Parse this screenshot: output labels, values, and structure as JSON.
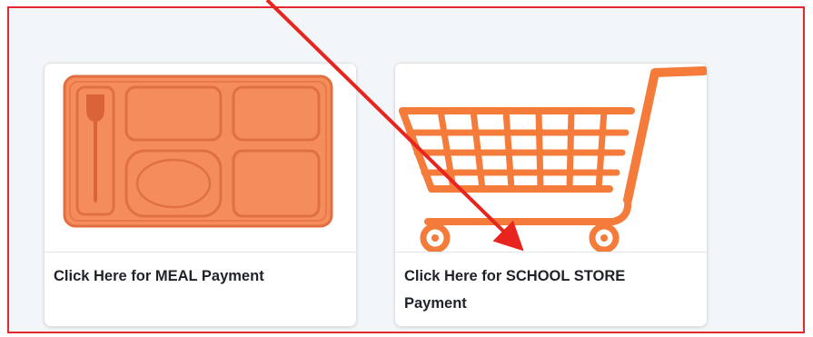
{
  "cards": [
    {
      "label": "Click Here for MEAL Payment",
      "icon": "meal-tray-icon"
    },
    {
      "label": "Click Here for SCHOOL STORE Payment",
      "icon": "shopping-cart-icon"
    }
  ],
  "colors": {
    "frame_border": "#e5282d",
    "annotation_arrow": "#e8241f",
    "icon_orange": "#f47b3a",
    "tray_fill": "#f58c5c",
    "background": "#f3f6f9"
  }
}
